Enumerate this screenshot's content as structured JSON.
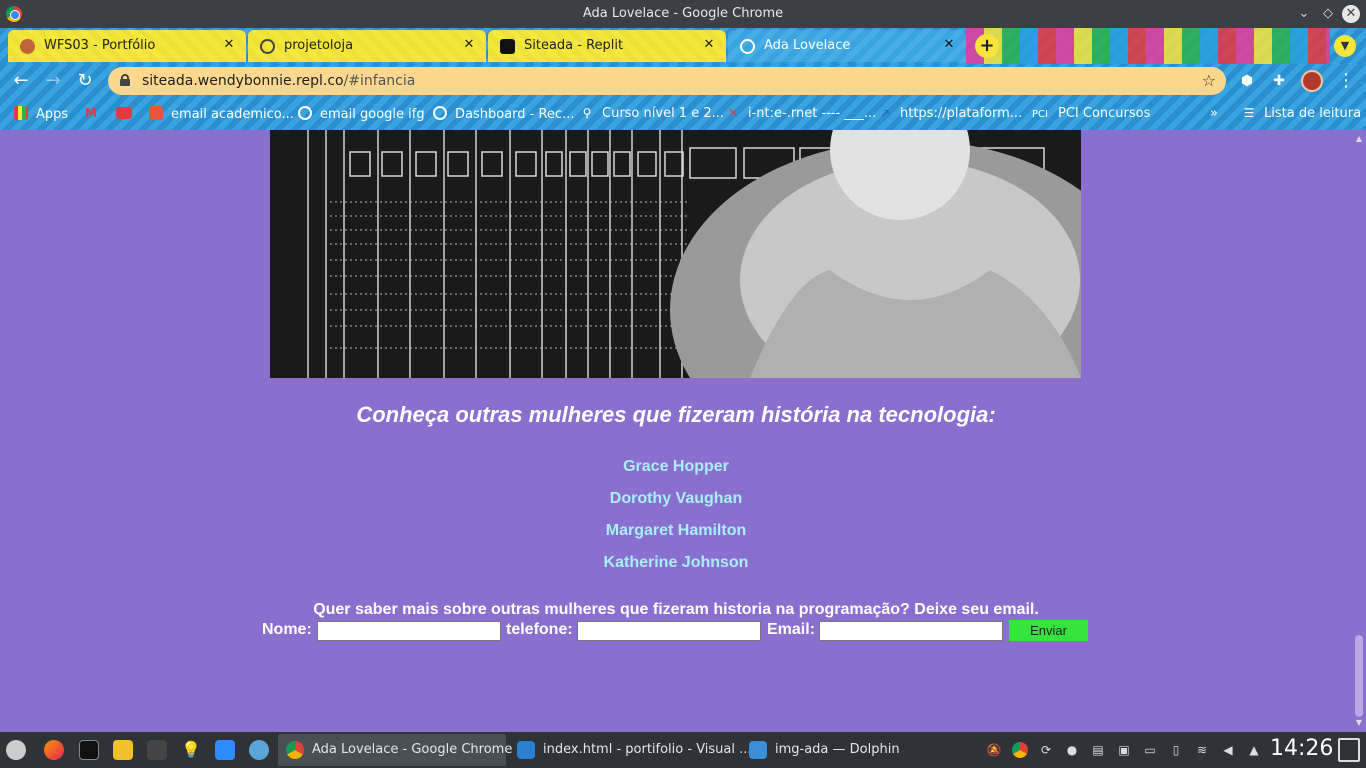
{
  "window": {
    "title": "Ada Lovelace - Google Chrome"
  },
  "tabs": [
    {
      "label": "WFS03 - Portfólio",
      "favicon": "avatar-icon"
    },
    {
      "label": "projetoloja",
      "favicon": "globe-icon"
    },
    {
      "label": "Siteada - Replit",
      "favicon": "replit-icon"
    },
    {
      "label": "Ada Lovelace",
      "favicon": "globe-icon",
      "active": true
    }
  ],
  "toolbar": {
    "url_host": "siteada.wendybonnie.repl.co",
    "url_path": "/#infancia"
  },
  "bookmarks": [
    {
      "label": "Apps",
      "icon": "apps-grid-icon"
    },
    {
      "label": "",
      "icon": "gmail-icon"
    },
    {
      "label": "",
      "icon": "youtube-icon"
    },
    {
      "label": "email academico...",
      "icon": "office-icon"
    },
    {
      "label": "email google ifg",
      "icon": "globe-icon"
    },
    {
      "label": "Dashboard - Rec...",
      "icon": "globe-icon"
    },
    {
      "label": "Curso nível 1 e 2...",
      "icon": "clip-icon"
    },
    {
      "label": "i-nt:e-.rnet ---- ___...",
      "icon": "x-logo-icon"
    },
    {
      "label": "https://plataform...",
      "icon": "link-icon"
    },
    {
      "label": "PCI Concursos",
      "icon": "pci-icon"
    }
  ],
  "bookmarks_more": "»",
  "reading_list": "Lista de leitura",
  "page": {
    "heading": "Conheça outras mulheres que fizeram história na tecnologia:",
    "women": [
      "Grace Hopper",
      "Dorothy Vaughan",
      "Margaret Hamilton",
      "Katherine Johnson"
    ],
    "cta": "Quer saber mais sobre outras mulheres que fizeram historia na programação? Deixe seu email.",
    "form": {
      "name_label": "Nome:",
      "phone_label": "telefone:",
      "email_label": "Email:",
      "name_value": "",
      "phone_value": "",
      "email_value": "",
      "submit_label": "Enviar"
    }
  },
  "taskbar": {
    "tasks": [
      {
        "label": "Ada Lovelace - Google Chrome",
        "active": true
      },
      {
        "label": "index.html - portifolio - Visual ..."
      },
      {
        "label": "img-ada — Dolphin"
      }
    ],
    "clock": "14:26"
  },
  "colors": {
    "page_background": "#8a6fcf",
    "link": "#a6f1fb",
    "submit_button": "#36e53b",
    "omnibox": "#fbd88d"
  }
}
